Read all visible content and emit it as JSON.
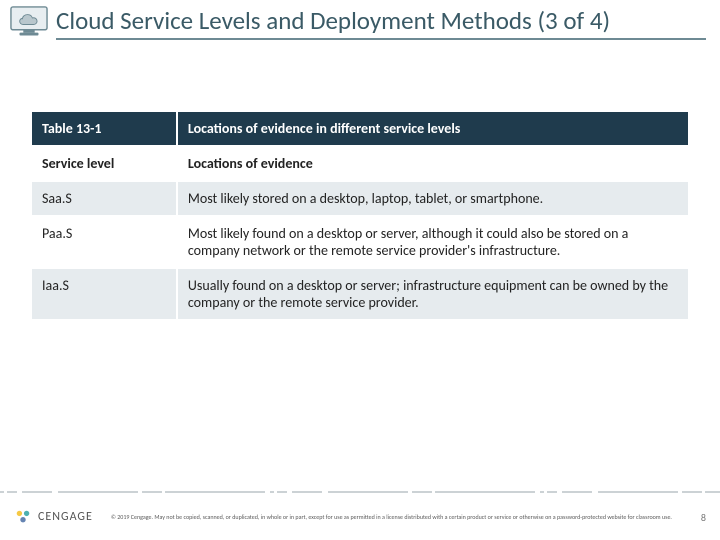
{
  "title": "Cloud Service Levels and Deployment Methods (3 of 4)",
  "table": {
    "header": {
      "left": "Table 13-1",
      "right": "Locations of evidence in different service levels"
    },
    "subheader": {
      "left": "Service level",
      "right": "Locations of evidence"
    },
    "rows": [
      {
        "level": "Saa.S",
        "text": "Most likely stored on a desktop, laptop, tablet, or smartphone."
      },
      {
        "level": "Paa.S",
        "text": "Most likely found on a desktop or server, although it could also be stored on a company network or the remote service provider's infrastructure."
      },
      {
        "level": "Iaa.S",
        "text": "Usually found on a desktop or server; infrastructure equipment can be owned by the company or the remote service provider."
      }
    ]
  },
  "brand": "CENGAGE",
  "copyright": "© 2019 Cengage. May not be copied, scanned, or duplicated, in whole or in part, except for use as permitted in a license distributed with a certain product or service or otherwise on a password-protected website for classroom use.",
  "page": "8"
}
